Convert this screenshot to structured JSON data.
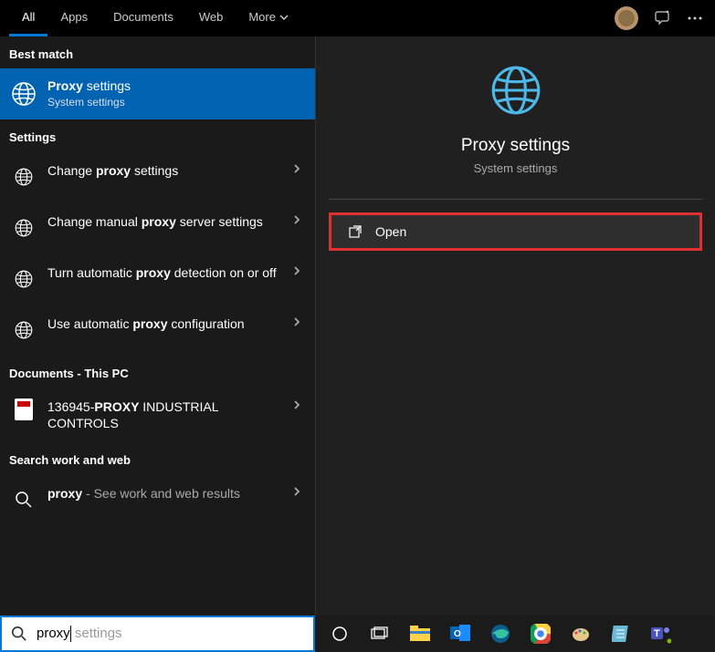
{
  "topbar": {
    "tabs": [
      "All",
      "Apps",
      "Documents",
      "Web",
      "More"
    ]
  },
  "sections": {
    "best_match": "Best match",
    "settings": "Settings",
    "documents": "Documents - This PC",
    "search_web": "Search work and web"
  },
  "best_match_result": {
    "title_prefix": "Proxy",
    "title_suffix": " settings",
    "subtitle": "System settings"
  },
  "settings_items": [
    {
      "prefix": "Change ",
      "bold": "proxy",
      "suffix": " settings"
    },
    {
      "prefix": "Change manual ",
      "bold": "proxy",
      "suffix": " server settings"
    },
    {
      "prefix": "Turn automatic ",
      "bold": "proxy",
      "suffix": " detection on or off"
    },
    {
      "prefix": "Use automatic ",
      "bold": "proxy",
      "suffix": " configuration"
    }
  ],
  "document_item": {
    "prefix": "136945-",
    "bold": "PROXY",
    "suffix": " INDUSTRIAL CONTROLS"
  },
  "web_item": {
    "bold": "proxy",
    "suffix": " - See work and web results"
  },
  "preview": {
    "title": "Proxy settings",
    "subtitle": "System settings",
    "open_label": "Open"
  },
  "search": {
    "typed": "proxy",
    "hint": " settings"
  }
}
